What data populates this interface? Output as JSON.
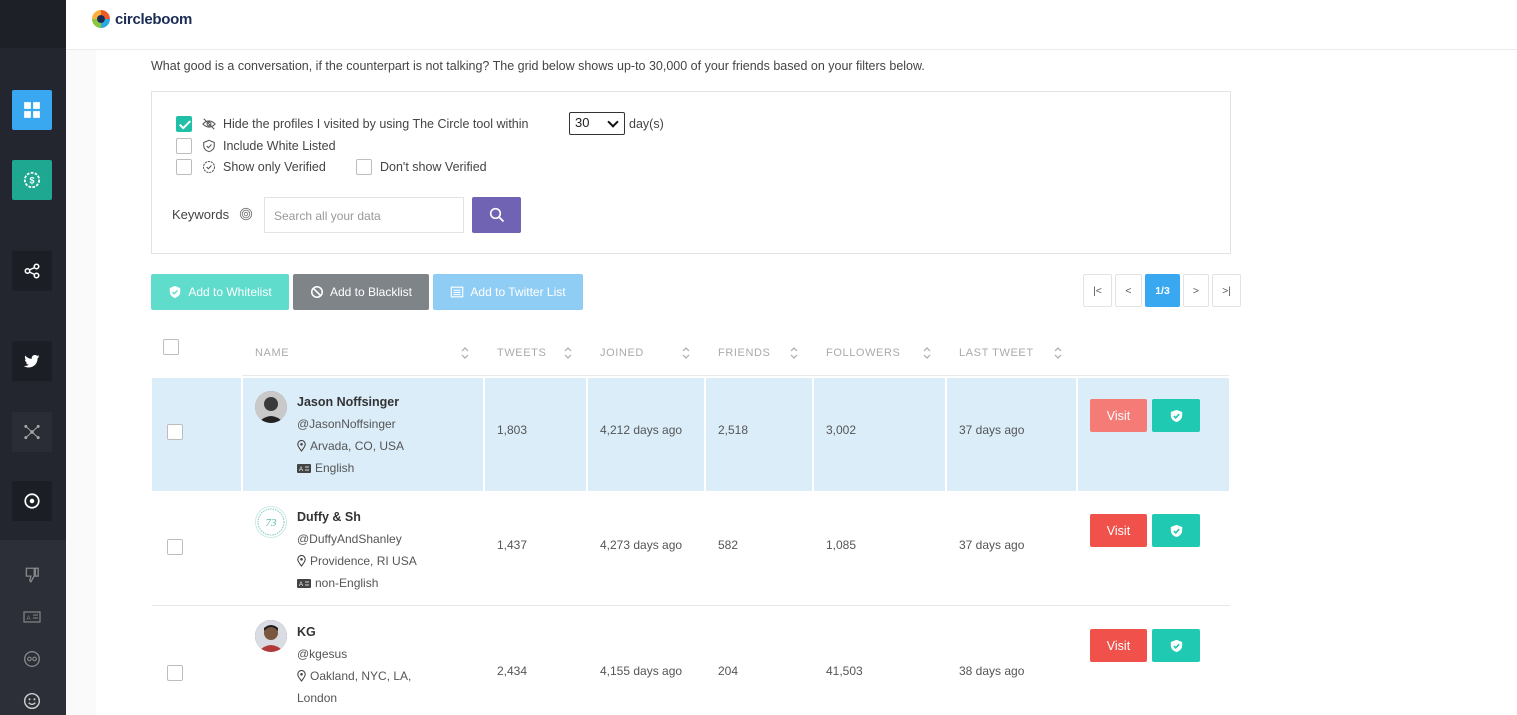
{
  "app": {
    "logo_text": "circleboom"
  },
  "sidebar": {
    "items": [
      {
        "name": "dashboard-icon",
        "color": "#3aa8f0"
      },
      {
        "name": "pricing-icon",
        "color": "#1ea891"
      },
      {
        "name": "share-icon"
      },
      {
        "name": "twitter-icon"
      },
      {
        "name": "network-icon"
      },
      {
        "name": "target-icon"
      },
      {
        "name": "dislike-icon"
      },
      {
        "name": "language-icon"
      },
      {
        "name": "eggs-icon"
      },
      {
        "name": "smile-icon"
      }
    ]
  },
  "intro_text": "What good is a conversation, if the counterpart is not talking? The grid below shows up-to 30,000 of your friends based on your filters below.",
  "filters": {
    "hide_visited_label": "Hide the profiles I visited by using The Circle tool within",
    "hide_visited_checked": true,
    "days_value": "30",
    "days_unit": "day(s)",
    "include_whitelisted_label": "Include White Listed",
    "show_verified_label": "Show only Verified",
    "dont_show_verified_label": "Don't show Verified",
    "keywords_label": "Keywords",
    "search_placeholder": "Search all your data"
  },
  "actions": {
    "whitelist_label": "Add to Whitelist",
    "blacklist_label": "Add to Blacklist",
    "twitter_list_label": "Add to Twitter List"
  },
  "pagination": {
    "first": "|<",
    "prev": "<",
    "current": "1/3",
    "next": ">",
    "last": ">|"
  },
  "table": {
    "columns": [
      "NAME",
      "TWEETS",
      "JOINED",
      "FRIENDS",
      "FOLLOWERS",
      "LAST TWEET"
    ],
    "visit_label": "Visit",
    "rows": [
      {
        "name": "Jason Noffsinger",
        "handle": "@JasonNoffsinger",
        "location": "Arvada, CO, USA",
        "language": "English",
        "tweets": "1,803",
        "joined": "4,212 days ago",
        "friends": "2,518",
        "followers": "3,002",
        "last_tweet": "37 days ago",
        "selected": true
      },
      {
        "name": "Duffy & Sh",
        "handle": "@DuffyAndShanley",
        "location": "Providence, RI USA",
        "language": "non-English",
        "tweets": "1,437",
        "joined": "4,273 days ago",
        "friends": "582",
        "followers": "1,085",
        "last_tweet": "37 days ago",
        "selected": false
      },
      {
        "name": "KG",
        "handle": "@kgesus",
        "location": "Oakland, NYC, LA,",
        "location_line2": "London",
        "tweets": "2,434",
        "joined": "4,155 days ago",
        "friends": "204",
        "followers": "41,503",
        "last_tweet": "38 days ago",
        "selected": false
      }
    ]
  },
  "colors": {
    "accent_teal": "#1fc9b2",
    "accent_blue": "#3aa8f0",
    "visit_red": "#f0514b",
    "search_purple": "#7163b4"
  }
}
